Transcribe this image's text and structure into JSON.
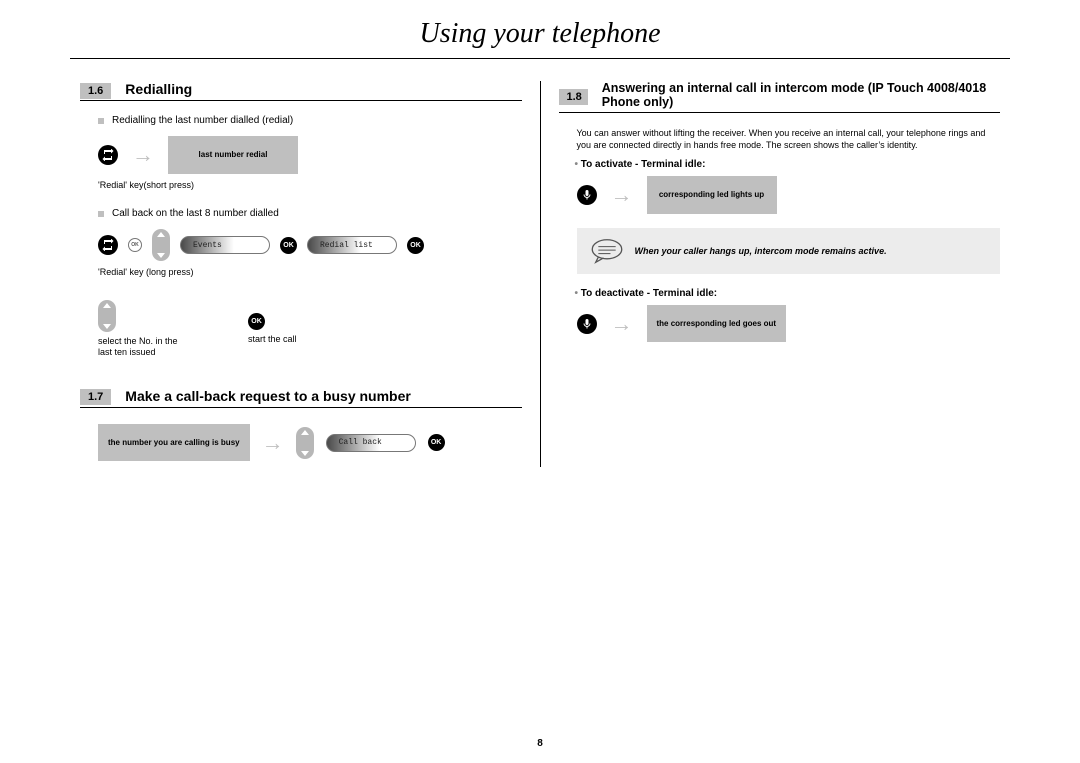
{
  "page_title": "Using your telephone",
  "page_number": "8",
  "left": {
    "s16": {
      "num": "1.6",
      "title": "Redialling",
      "note1": "Redialling the last number dialled (redial)",
      "redial_caption": "'Redial' key(short press)",
      "last_number_box": "last number redial",
      "note2": "Call back on the last 8 number dialled",
      "redial_long_caption": "'Redial' key (long press)",
      "ok_label": "OK",
      "events_pill": "Events",
      "redial_list_pill": "Redial list",
      "select_caption": "select the No. in the last ten issued",
      "start_caption": "start the call"
    },
    "s17": {
      "num": "1.7",
      "title": "Make a call-back request to a busy number",
      "busy_box": "the number you are calling is busy",
      "callback_pill": "Call back",
      "ok_label": "OK"
    }
  },
  "right": {
    "s18": {
      "num": "1.8",
      "title": "Answering an internal call in intercom mode (IP Touch 4008/4018 Phone only)",
      "body": "You can answer without lifting the receiver. When you receive an internal call, your telephone rings and you are connected directly in hands free mode. The screen shows the caller’s identity.",
      "activate_label": "To activate - Terminal idle:",
      "activate_box": "corresponding led lights up",
      "tip_text": "When your caller hangs up, intercom mode remains active.",
      "deactivate_label": "To deactivate - Terminal idle:",
      "deactivate_box": "the corresponding led goes out"
    }
  }
}
